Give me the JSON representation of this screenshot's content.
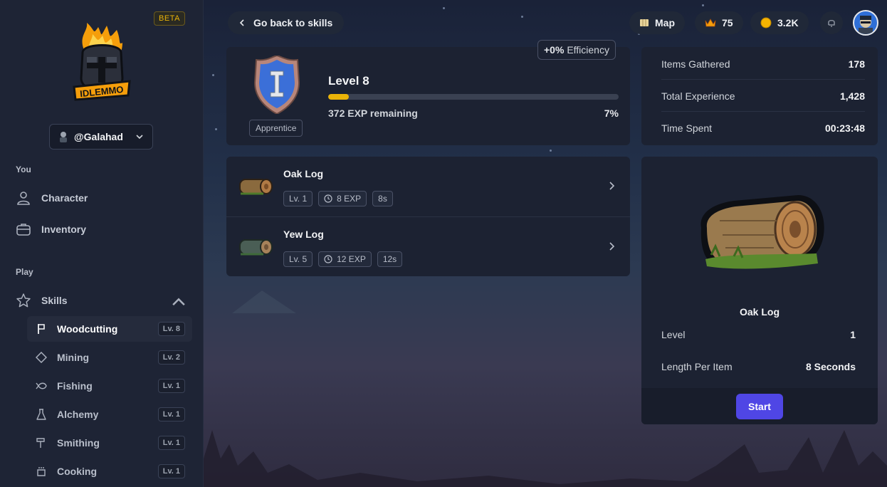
{
  "sidebar": {
    "beta": "BETA",
    "logo_text": "IDLEMMO",
    "username": "@Galahad",
    "section_you": "You",
    "you_items": [
      {
        "label": "Character",
        "icon": "user-icon"
      },
      {
        "label": "Inventory",
        "icon": "briefcase-icon"
      }
    ],
    "section_play": "Play",
    "skills_label": "Skills",
    "skills": [
      {
        "label": "Woodcutting",
        "level": "Lv. 8",
        "icon": "axe-icon",
        "active": true
      },
      {
        "label": "Mining",
        "level": "Lv. 2",
        "icon": "diamond-icon"
      },
      {
        "label": "Fishing",
        "level": "Lv. 1",
        "icon": "fish-icon"
      },
      {
        "label": "Alchemy",
        "level": "Lv. 1",
        "icon": "flask-icon"
      },
      {
        "label": "Smithing",
        "level": "Lv. 1",
        "icon": "hammer-icon"
      },
      {
        "label": "Cooking",
        "level": "Lv. 1",
        "icon": "pot-icon"
      }
    ]
  },
  "header": {
    "back_label": "Go back to skills",
    "map_label": "Map",
    "crowns": "75",
    "gold": "3.2K"
  },
  "level_card": {
    "efficiency_value": "+0%",
    "efficiency_label": "Efficiency",
    "rank": "Apprentice",
    "level_title": "Level 8",
    "exp_remaining": "372 EXP remaining",
    "progress_percent": "7%",
    "progress_value": 7
  },
  "stats": [
    {
      "label": "Items Gathered",
      "value": "178"
    },
    {
      "label": "Total Experience",
      "value": "1,428"
    },
    {
      "label": "Time Spent",
      "value": "00:23:48"
    }
  ],
  "items": [
    {
      "name": "Oak Log",
      "level": "Lv. 1",
      "exp": "8 EXP",
      "time": "8s"
    },
    {
      "name": "Yew Log",
      "level": "Lv. 5",
      "exp": "12 EXP",
      "time": "12s"
    }
  ],
  "detail": {
    "name": "Oak Log",
    "level_label": "Level",
    "level_value": "1",
    "length_label": "Length Per Item",
    "length_value": "8 Seconds",
    "start_label": "Start"
  },
  "colors": {
    "accent": "#4f46e5",
    "progress": "#eab308",
    "beta": "#eab308"
  }
}
